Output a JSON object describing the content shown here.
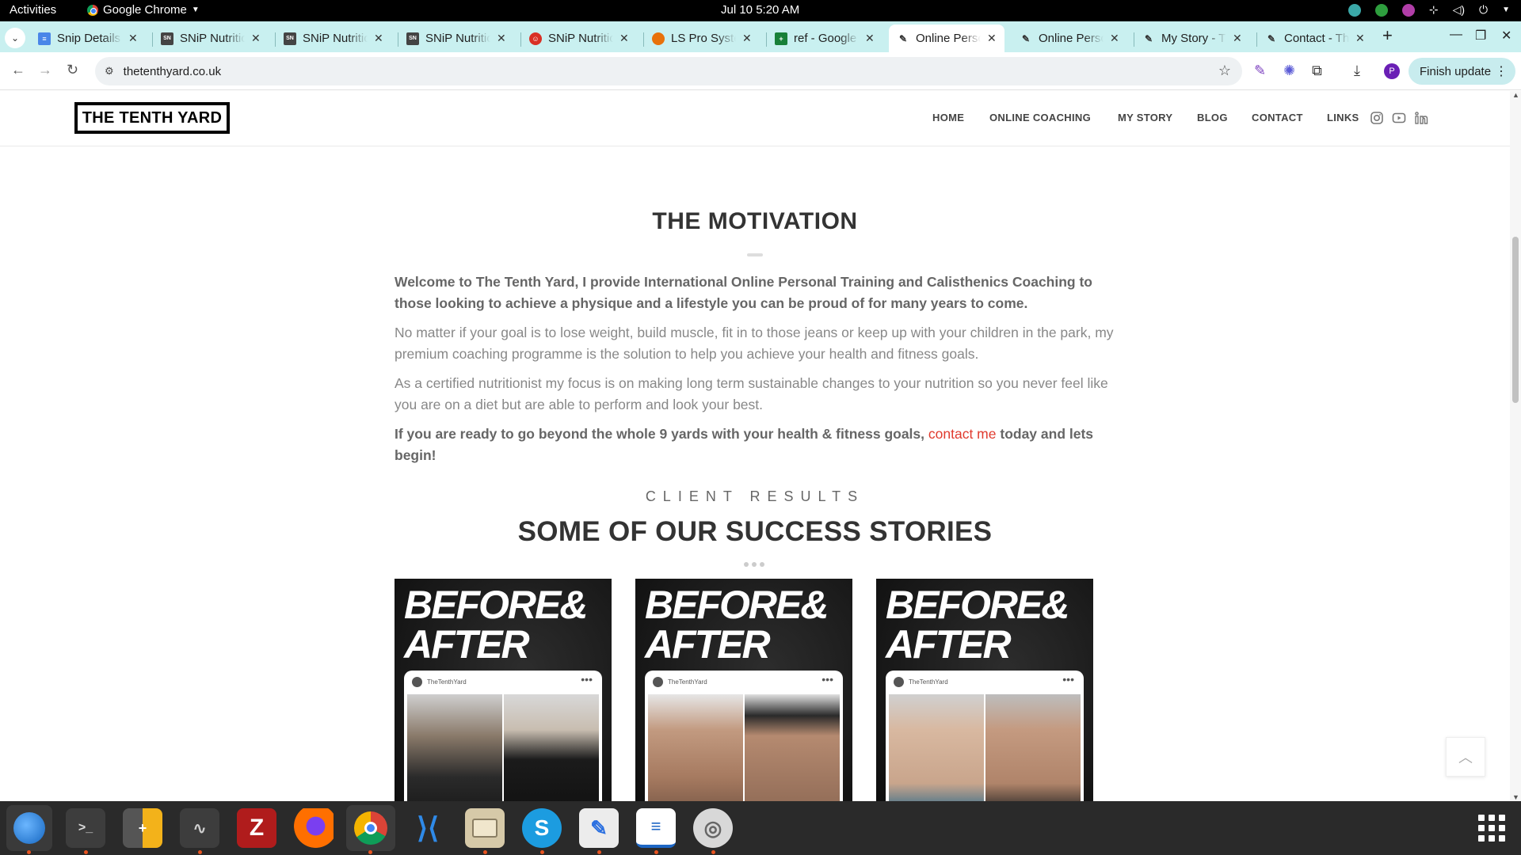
{
  "gnome": {
    "activities": "Activities",
    "app_name": "Google Chrome",
    "clock": "Jul 10  5:20 AM"
  },
  "tabs": [
    {
      "label": "Snip Details",
      "icon": "docs-icon",
      "color": "#4a86e8"
    },
    {
      "label": "SNiP Nutrition",
      "icon": "snip-icon",
      "color": "#444444"
    },
    {
      "label": "SNiP Nutrition",
      "icon": "snip-icon",
      "color": "#444444"
    },
    {
      "label": "SNiP Nutrition",
      "icon": "snip-icon",
      "color": "#444444"
    },
    {
      "label": "SNiP Nutrition",
      "icon": "snip-face-icon",
      "color": "#d93025"
    },
    {
      "label": "LS Pro System",
      "icon": "ls-icon",
      "color": "#e8710a"
    },
    {
      "label": "ref - Google Sheets",
      "icon": "sheets-icon",
      "color": "#188038"
    },
    {
      "label": "Online Personal",
      "icon": "tenthyard-icon",
      "color": "#333333"
    },
    {
      "label": "Online Personal",
      "icon": "tenthyard-icon",
      "color": "#333333"
    },
    {
      "label": "My Story - The",
      "icon": "tenthyard-icon",
      "color": "#333333"
    },
    {
      "label": "Contact - The",
      "icon": "tenthyard-icon",
      "color": "#333333"
    }
  ],
  "toolbar": {
    "url": "thetenthyard.co.uk",
    "finish_update": "Finish update",
    "avatar_letter": "P"
  },
  "site": {
    "logo": "THE TENTH YARD",
    "nav": [
      "HOME",
      "ONLINE COACHING",
      "MY STORY",
      "BLOG",
      "CONTACT",
      "LINKS"
    ]
  },
  "motivation": {
    "title": "THE MOTIVATION",
    "intro": "Welcome to The Tenth Yard, I provide International Online Personal Training and Calisthenics Coaching to those looking to achieve a physique and a lifestyle you can be proud of for many years to come.",
    "para2": "No matter if your goal is to lose weight, build muscle, fit in to those jeans or keep up with your children in the park, my premium coaching programme is the solution to help you achieve your health and fitness goals.",
    "para3": "As a certified nutritionist my focus is on making long term sustainable changes to your nutrition so you never feel like you are on a diet but are able to perform and look your best.",
    "cta_before": "If you are ready to go beyond the whole 9 yards with your health & fitness goals, ",
    "cta_link": "contact me",
    "cta_after": " today and lets begin!"
  },
  "results": {
    "kicker": "CLIENT RESULTS",
    "title": "SOME OF OUR SUCCESS STORIES",
    "cards": [
      {
        "headline_1": "BEFORE&",
        "headline_2": "AFTER",
        "account": "TheTenthYard"
      },
      {
        "headline_1": "BEFORE&",
        "headline_2": "AFTER",
        "account": "TheTenthYard"
      },
      {
        "headline_1": "BEFORE&",
        "headline_2": "AFTER",
        "account": "TheTenthYard"
      }
    ]
  },
  "colors": {
    "tabstrip": "#c9f0f0",
    "accent_link": "#e03b2e",
    "dock_indicator": "#e95420"
  }
}
